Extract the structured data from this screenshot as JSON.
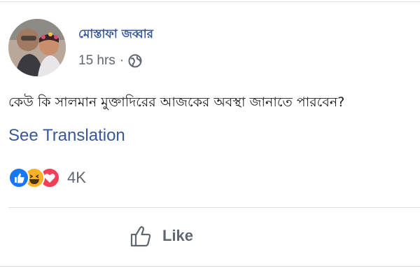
{
  "post": {
    "author": "মোস্তাফা জব্বার",
    "time": "15 hrs",
    "separator": "·",
    "privacy_icon": "globe-icon",
    "text": "কেউ কি সালমান মুক্তাদিরের আজকের অবস্থা জানাতে পারবেন?",
    "see_translation": "See Translation"
  },
  "reactions": {
    "types": [
      "like",
      "haha",
      "love"
    ],
    "count": "4K"
  },
  "actions": {
    "like_label": "Like"
  },
  "colors": {
    "link": "#385898",
    "like_blue": "#1877f2",
    "haha_yellow": "#f7b125",
    "love_red": "#f33e58"
  }
}
